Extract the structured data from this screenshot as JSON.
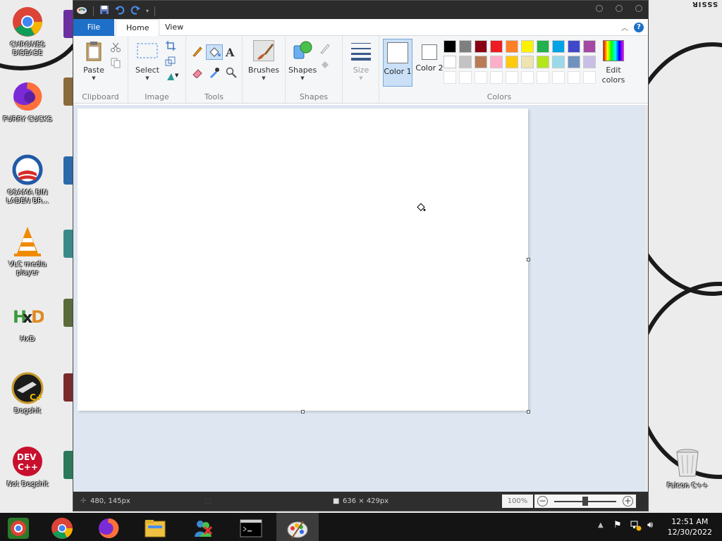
{
  "desktop": {
    "icons": [
      {
        "label": "CHRONES DISEASE",
        "icon": "chrome-icon"
      },
      {
        "label": "FURRY CUCKS",
        "icon": "firefox-icon"
      },
      {
        "label": "OSAMA BIN LADEN BR...",
        "icon": "obama-logo-icon"
      },
      {
        "label": "VLC media player",
        "icon": "vlc-cone-icon"
      },
      {
        "label": "HxD",
        "icon": "hxd-icon"
      },
      {
        "label": "Dogshit",
        "icon": "code-blocks-icon"
      },
      {
        "label": "Not Dogshit",
        "icon": "dev-cpp-icon"
      }
    ],
    "recycle_bin": {
      "label": "Falcon C++",
      "icon": "recycle-bin-icon"
    },
    "wallpaper_text": "SSSIR"
  },
  "paint": {
    "tabs": {
      "file": "File",
      "home": "Home",
      "view": "View"
    },
    "groups": {
      "clipboard": {
        "label": "Clipboard",
        "paste": "Paste"
      },
      "image": {
        "label": "Image",
        "select": "Select"
      },
      "tools": {
        "label": "Tools"
      },
      "brushes": {
        "label": "Brushes"
      },
      "shapes": {
        "label": "Shapes",
        "shapes": "Shapes"
      },
      "size": {
        "label": "Size"
      },
      "colors": {
        "label": "Colors",
        "color1": "Color 1",
        "color1_num": "1",
        "color2": "Color 2",
        "color2_num": "2",
        "edit": "Edit colors",
        "edit_line1": "Edit",
        "edit_line2": "colors"
      }
    },
    "palette": [
      "#000000",
      "#7f7f7f",
      "#880015",
      "#ed1c24",
      "#ff7f27",
      "#fff200",
      "#22b14c",
      "#00a2e8",
      "#3f48cc",
      "#a349a4",
      "#ffffff",
      "#c3c3c3",
      "#b97a57",
      "#ffaec9",
      "#ffc90e",
      "#efe4b0",
      "#b5e61d",
      "#99d9ea",
      "#7092be",
      "#c8bfe7",
      "#ffffff",
      "#ffffff",
      "#ffffff",
      "#ffffff",
      "#ffffff",
      "#ffffff",
      "#ffffff",
      "#ffffff",
      "#ffffff",
      "#ffffff"
    ],
    "status": {
      "cursor_pos": "480, 145px",
      "canvas_size": "636 × 429px",
      "zoom": "100%"
    }
  },
  "taskbar": {
    "apps": [
      "chrome-alt-icon",
      "chrome-icon",
      "firefox-icon",
      "file-explorer-icon",
      "msn-icon",
      "cmd-icon",
      "paint-icon"
    ],
    "time": "12:51 AM",
    "date": "12/30/2022"
  }
}
